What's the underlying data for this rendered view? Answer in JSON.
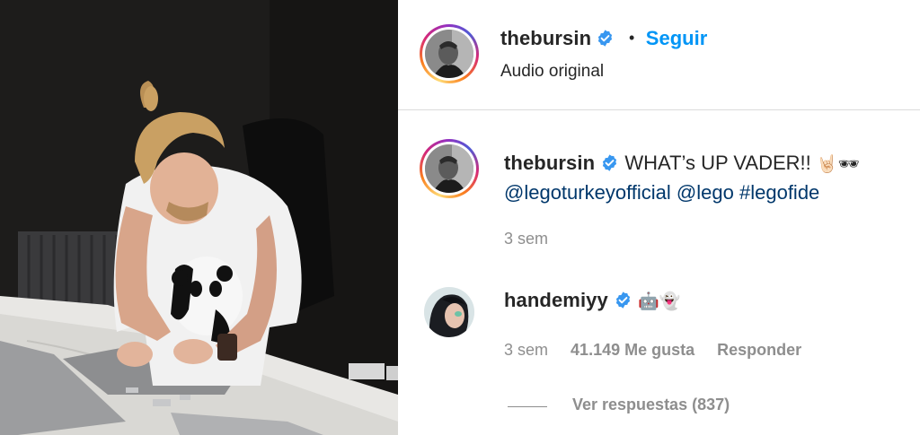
{
  "post": {
    "author": "thebursin",
    "follow_label": "Seguir",
    "separator": "•",
    "audio_label": "Audio original"
  },
  "caption": {
    "author": "thebursin",
    "text": "WHAT’s UP VADER!!",
    "emojis": "🤘🏻🕶",
    "mentions": [
      "@legoturkeyofficial",
      "@lego",
      "#legofide"
    ],
    "time": "3 sem"
  },
  "comment": {
    "author": "handemiyy",
    "emojis": "🤖👻",
    "time": "3 sem",
    "likes": "41.149 Me gusta",
    "reply_label": "Responder",
    "view_replies": "Ver respuestas (837)"
  },
  "icons": {
    "verified": "verified-badge-icon"
  },
  "colors": {
    "accent": "#0095f6",
    "link": "#00376b",
    "muted": "#8e8e8e",
    "verified": "#3897f0"
  }
}
